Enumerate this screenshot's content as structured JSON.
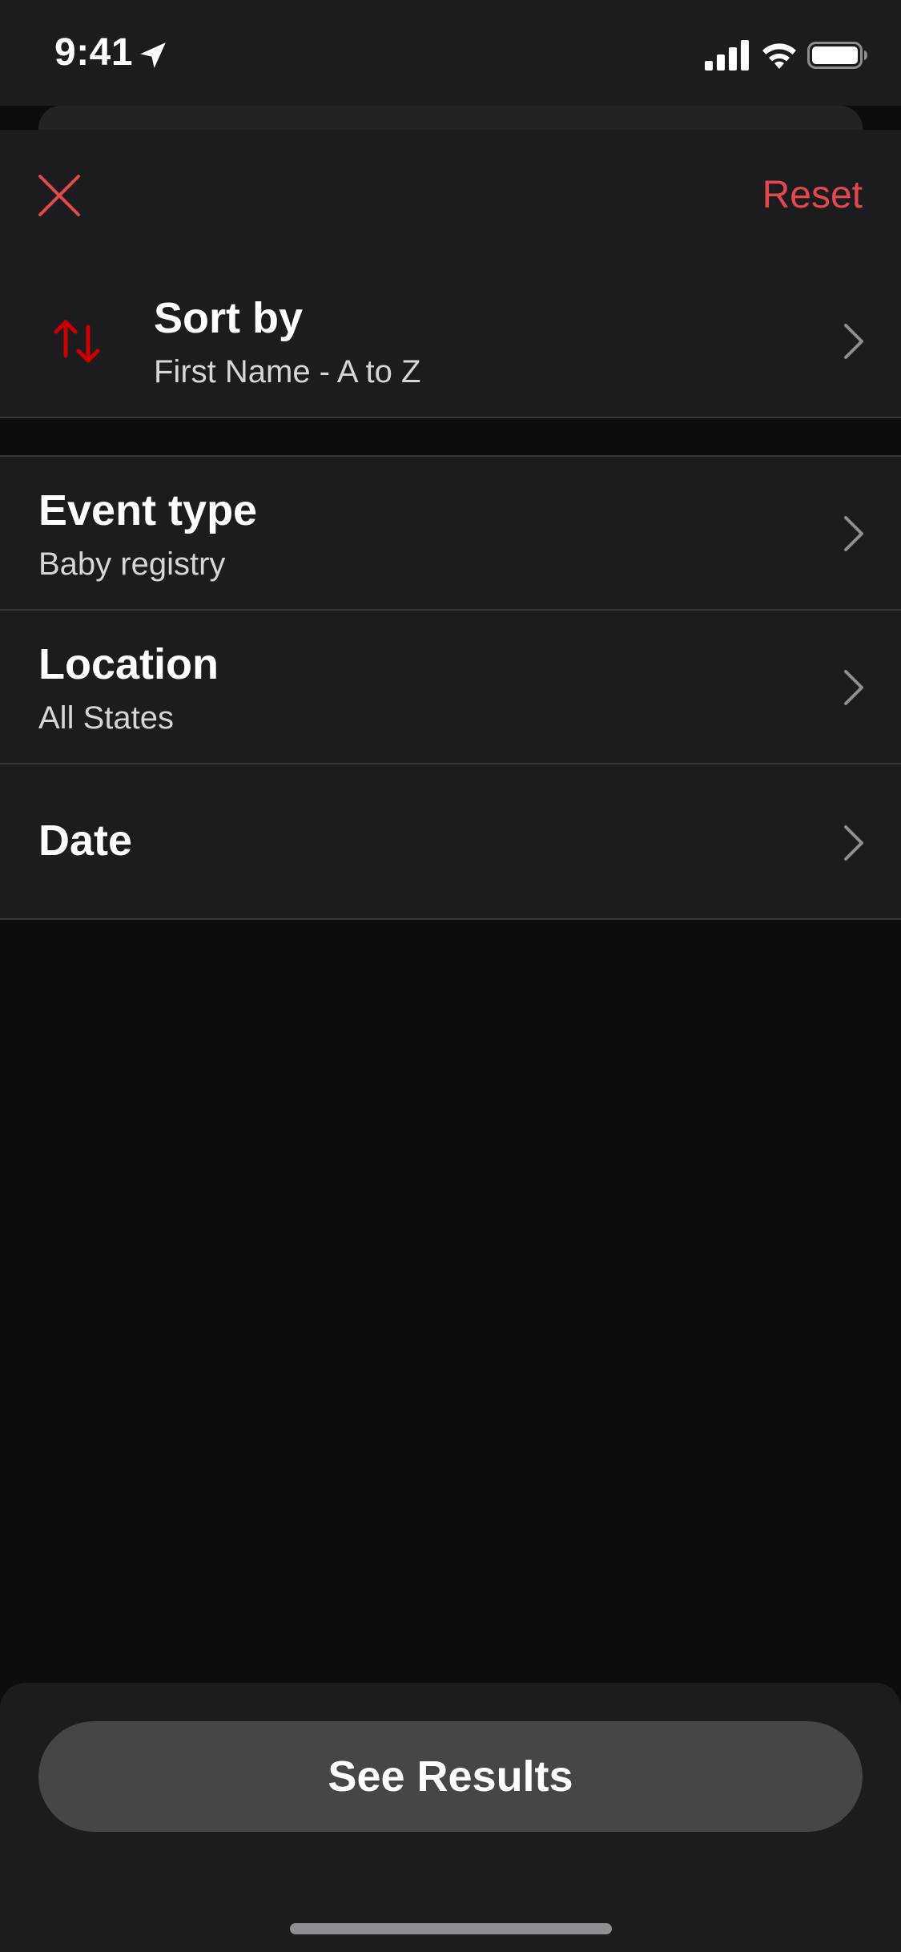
{
  "status_bar": {
    "time": "9:41"
  },
  "header": {
    "reset_label": "Reset"
  },
  "rows": {
    "sort": {
      "title": "Sort by",
      "value": "First Name - A to Z"
    },
    "event_type": {
      "title": "Event type",
      "value": "Baby registry"
    },
    "location": {
      "title": "Location",
      "value": "All States"
    },
    "date": {
      "title": "Date"
    }
  },
  "footer": {
    "see_results_label": "See Results"
  },
  "colors": {
    "accent": "#e2484d",
    "background": "#0d0d0d",
    "surface": "#1c1c1e",
    "button": "#464648"
  },
  "icons": {
    "close": "close-icon",
    "sort": "sort-arrows-icon",
    "chevron": "chevron-right-icon"
  }
}
